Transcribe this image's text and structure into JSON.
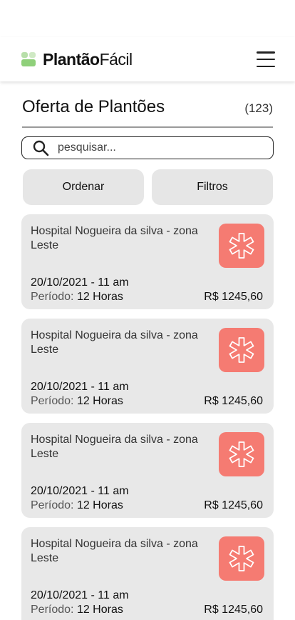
{
  "brand": {
    "name_bold": "Plantão",
    "name_light": "Fácil"
  },
  "page": {
    "title": "Oferta de Plantões",
    "count": "(123)"
  },
  "search": {
    "placeholder": "pesquisar..."
  },
  "actions": {
    "sort_label": "Ordenar",
    "filter_label": "Filtros"
  },
  "colors": {
    "badge": "#f57b72",
    "card_bg": "#e8e8e8",
    "logo_green": "#8fd07a"
  },
  "offers": [
    {
      "hospital": "Hospital Nogueira da silva - zona Leste",
      "date": "20/10/2021  - 11 am",
      "period_label": "Período:",
      "period_value": "12 Horas",
      "price": "R$ 1245,60",
      "icon": "medical-asterisk-icon"
    },
    {
      "hospital": "Hospital Nogueira da silva - zona Leste",
      "date": "20/10/2021  - 11 am",
      "period_label": "Período:",
      "period_value": "12 Horas",
      "price": "R$ 1245,60",
      "icon": "medical-asterisk-icon"
    },
    {
      "hospital": "Hospital Nogueira da silva - zona Leste",
      "date": "20/10/2021  - 11 am",
      "period_label": "Período:",
      "period_value": "12 Horas",
      "price": "R$ 1245,60",
      "icon": "medical-asterisk-icon"
    },
    {
      "hospital": "Hospital Nogueira da silva - zona Leste",
      "date": "20/10/2021  - 11 am",
      "period_label": "Período:",
      "period_value": "12 Horas",
      "price": "R$ 1245,60",
      "icon": "medical-asterisk-icon"
    }
  ]
}
